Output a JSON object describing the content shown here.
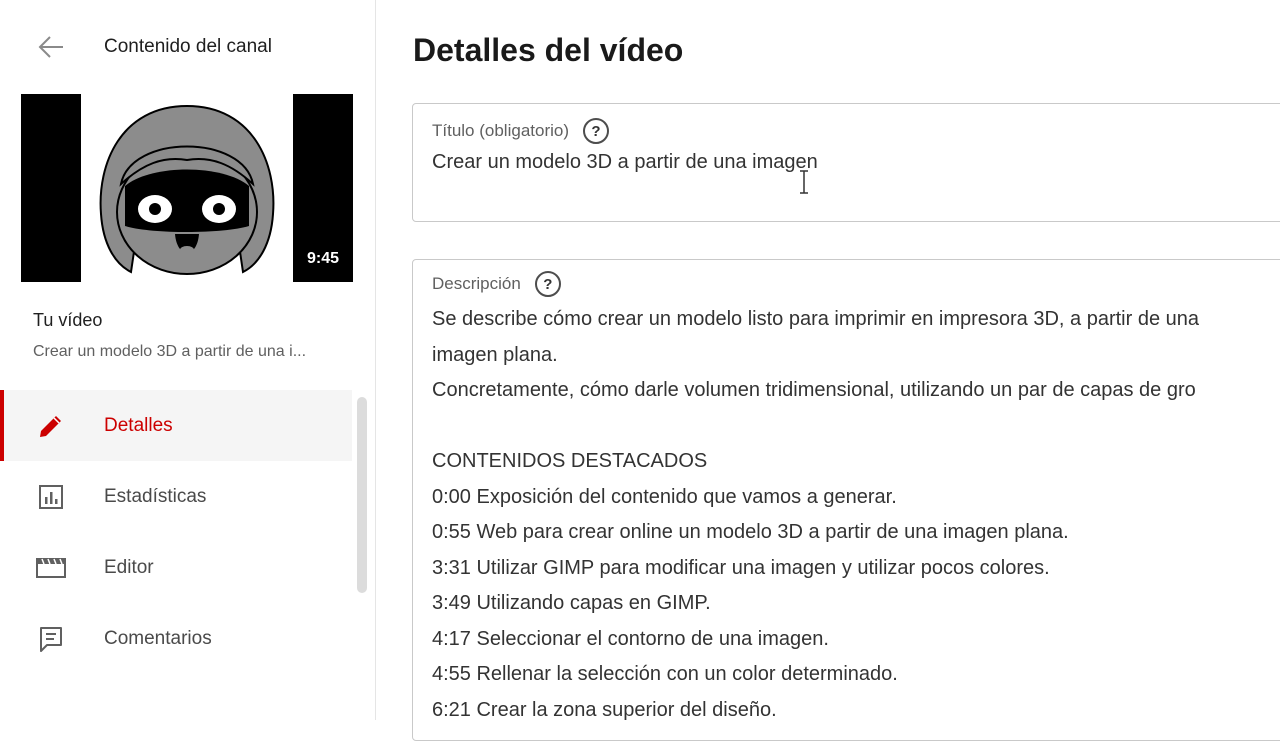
{
  "sidebar": {
    "title": "Contenido del canal",
    "thumbnail": {
      "duration": "9:45"
    },
    "your_video_label": "Tu vídeo",
    "video_title": "Crear un modelo 3D a partir de una i...",
    "nav": [
      {
        "label": "Detalles",
        "icon": "pencil-icon",
        "active": true
      },
      {
        "label": "Estadísticas",
        "icon": "analytics-icon",
        "active": false
      },
      {
        "label": "Editor",
        "icon": "clapperboard-icon",
        "active": false
      },
      {
        "label": "Comentarios",
        "icon": "comment-icon",
        "active": false
      }
    ]
  },
  "main": {
    "page_title": "Detalles del vídeo",
    "title_field": {
      "label": "Título (obligatorio)",
      "value": "Crear un modelo 3D a partir de una imagen",
      "help_glyph": "?"
    },
    "description_field": {
      "label": "Descripción",
      "help_glyph": "?",
      "lines": [
        "Se describe cómo crear un modelo listo para imprimir en impresora 3D, a partir de una",
        "imagen plana.",
        "Concretamente, cómo darle volumen tridimensional, utilizando un par de capas de gro",
        "",
        "CONTENIDOS DESTACADOS",
        "0:00 Exposición del contenido que vamos a generar.",
        "0:55 Web para crear online un modelo 3D a partir de una imagen plana.",
        "3:31 Utilizar GIMP para modificar una imagen y utilizar pocos colores.",
        "3:49 Utilizando capas en GIMP.",
        "4:17 Seleccionar el contorno de una imagen.",
        "4:55 Rellenar la selección con un color determinado.",
        "6:21 Crear la zona superior del diseño."
      ]
    }
  },
  "colors": {
    "accent": "#cc0000",
    "border": "#c9c9c9",
    "active_bg": "#f5f5f5"
  }
}
